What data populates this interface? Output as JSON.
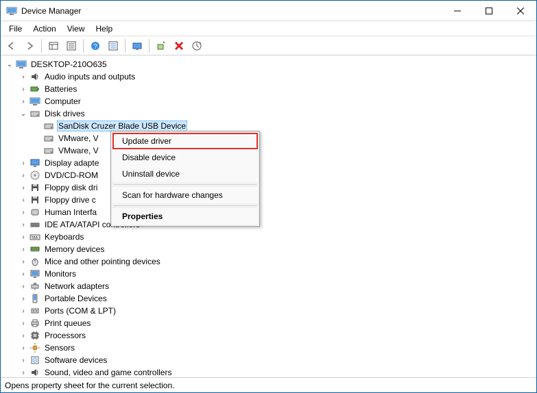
{
  "window": {
    "title": "Device Manager"
  },
  "menubar": [
    "File",
    "Action",
    "View",
    "Help"
  ],
  "toolbar_icons": [
    "back-icon",
    "forward-icon",
    "|",
    "show-hide-icon",
    "properties-icon",
    "|",
    "help-icon",
    "list-icon",
    "|",
    "monitor-icon",
    "|",
    "update-driver-icon",
    "uninstall-icon",
    "scan-icon"
  ],
  "tree": {
    "root_label": "DESKTOP-210O635",
    "nodes": [
      {
        "label": "Audio inputs and outputs",
        "icon": "audio-icon",
        "state": "collapsed"
      },
      {
        "label": "Batteries",
        "icon": "battery-icon",
        "state": "collapsed"
      },
      {
        "label": "Computer",
        "icon": "computer-icon",
        "state": "collapsed"
      },
      {
        "label": "Disk drives",
        "icon": "disk-icon",
        "state": "expanded",
        "children": [
          {
            "label": "SanDisk Cruzer Blade USB Device",
            "icon": "disk-icon",
            "selected": true
          },
          {
            "label": "VMware, V",
            "icon": "disk-icon"
          },
          {
            "label": "VMware, V",
            "icon": "disk-icon"
          }
        ]
      },
      {
        "label": "Display adapte",
        "icon": "display-icon",
        "state": "collapsed"
      },
      {
        "label": "DVD/CD-ROM",
        "icon": "dvd-icon",
        "state": "collapsed"
      },
      {
        "label": "Floppy disk dri",
        "icon": "floppy-icon",
        "state": "collapsed"
      },
      {
        "label": "Floppy drive c",
        "icon": "floppy-icon",
        "state": "collapsed"
      },
      {
        "label": "Human Interfa",
        "icon": "hid-icon",
        "state": "collapsed"
      },
      {
        "label": "IDE ATA/ATAPI controllers",
        "icon": "ide-icon",
        "state": "collapsed"
      },
      {
        "label": "Keyboards",
        "icon": "keyboard-icon",
        "state": "collapsed"
      },
      {
        "label": "Memory devices",
        "icon": "memory-icon",
        "state": "collapsed"
      },
      {
        "label": "Mice and other pointing devices",
        "icon": "mouse-icon",
        "state": "collapsed"
      },
      {
        "label": "Monitors",
        "icon": "monitor-icon",
        "state": "collapsed"
      },
      {
        "label": "Network adapters",
        "icon": "network-icon",
        "state": "collapsed"
      },
      {
        "label": "Portable Devices",
        "icon": "portable-icon",
        "state": "collapsed"
      },
      {
        "label": "Ports (COM & LPT)",
        "icon": "port-icon",
        "state": "collapsed"
      },
      {
        "label": "Print queues",
        "icon": "printer-icon",
        "state": "collapsed"
      },
      {
        "label": "Processors",
        "icon": "cpu-icon",
        "state": "collapsed"
      },
      {
        "label": "Sensors",
        "icon": "sensor-icon",
        "state": "collapsed"
      },
      {
        "label": "Software devices",
        "icon": "software-icon",
        "state": "collapsed"
      },
      {
        "label": "Sound, video and game controllers",
        "icon": "audio-icon",
        "state": "collapsed",
        "cut": true
      }
    ]
  },
  "context_menu": {
    "items": [
      {
        "label": "Update driver",
        "highlight": true
      },
      {
        "label": "Disable device"
      },
      {
        "label": "Uninstall device"
      },
      {
        "sep": true
      },
      {
        "label": "Scan for hardware changes"
      },
      {
        "sep": true
      },
      {
        "label": "Properties",
        "bold": true
      }
    ]
  },
  "statusbar": "Opens property sheet for the current selection."
}
